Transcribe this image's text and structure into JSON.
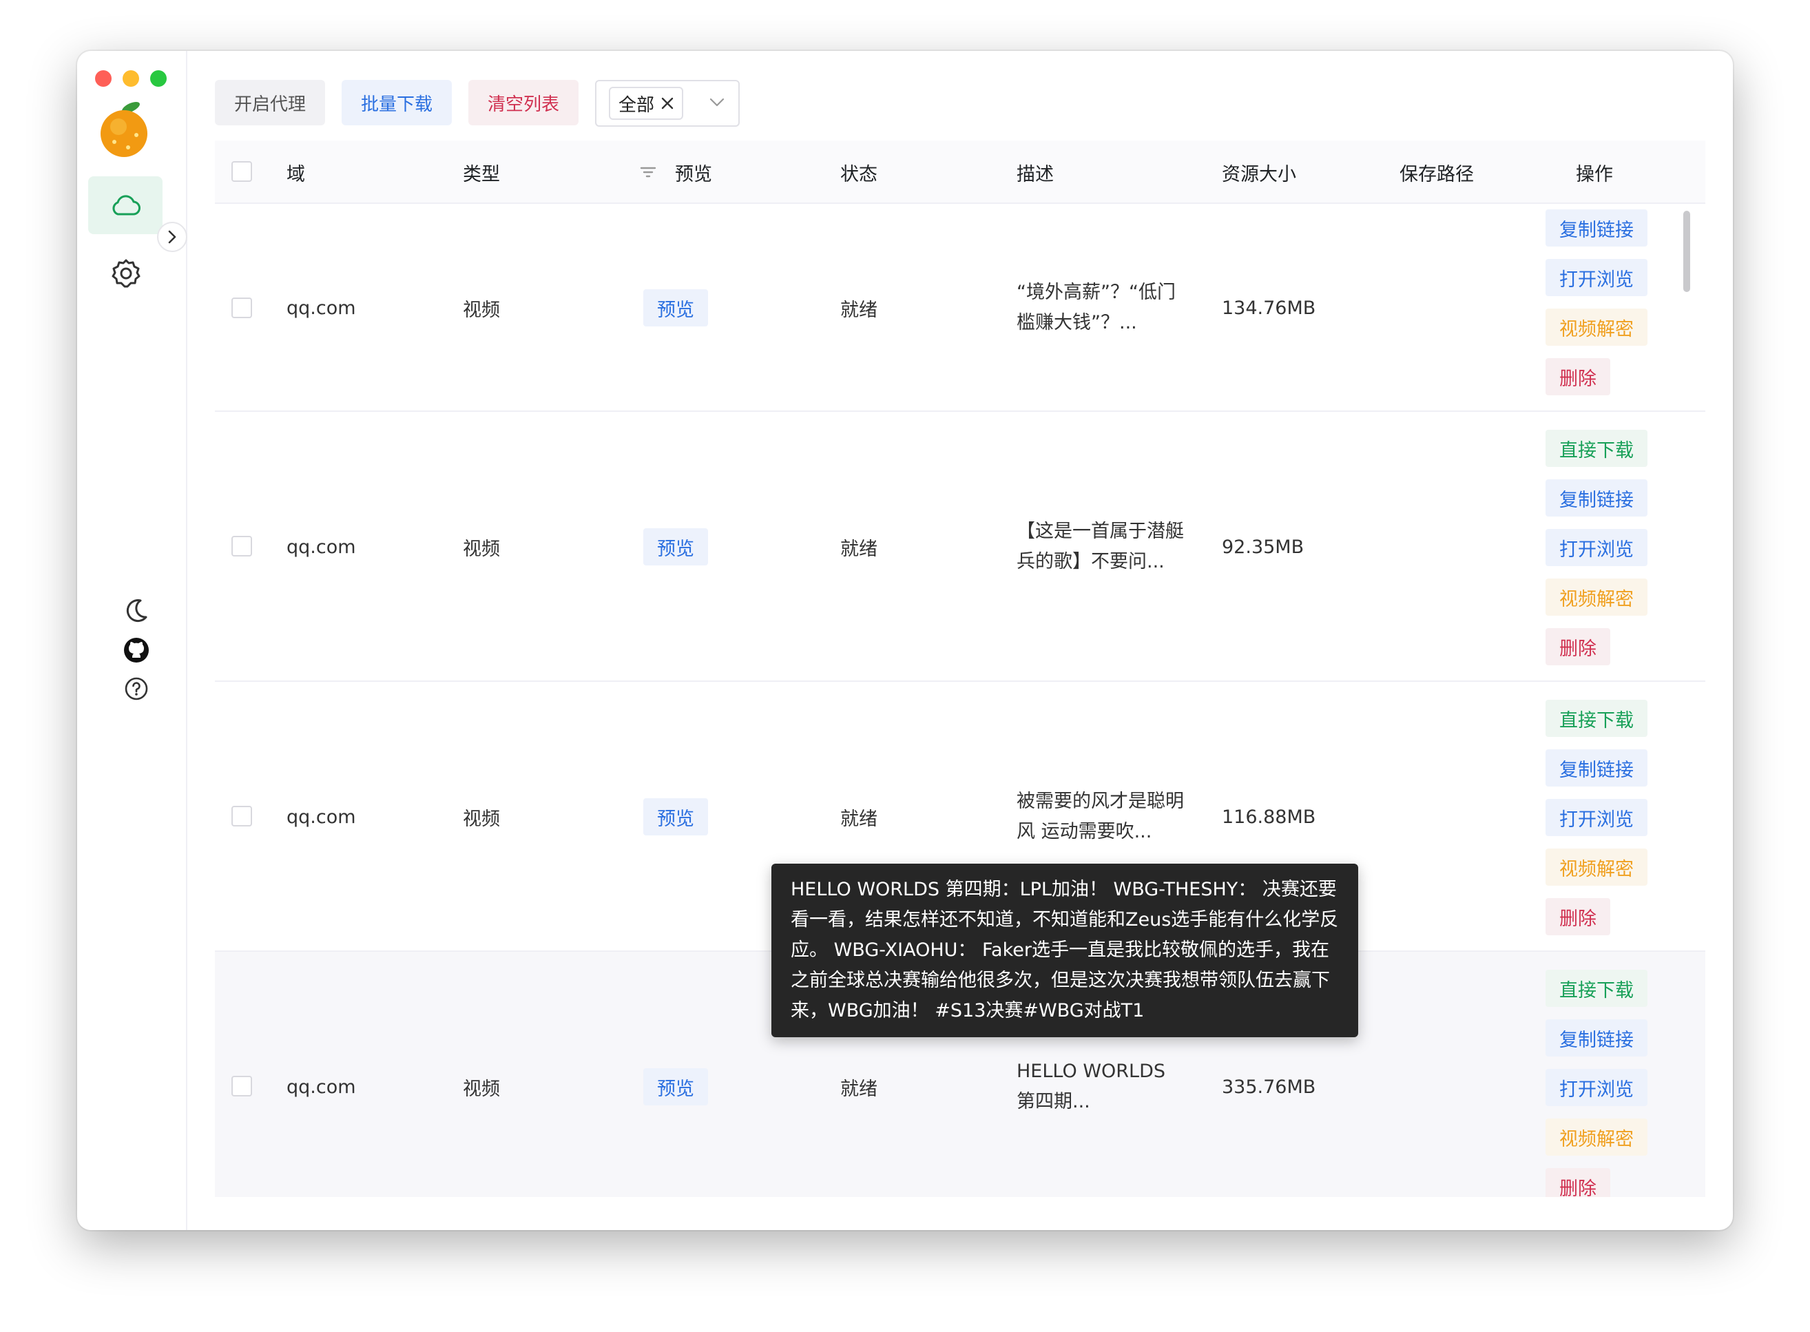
{
  "toolbar": {
    "proxy_label": "开启代理",
    "batch_download_label": "批量下载",
    "clear_list_label": "清空列表",
    "filter_tag": "全部"
  },
  "table": {
    "headers": {
      "domain": "域",
      "type": "类型",
      "preview": "预览",
      "status": "状态",
      "description": "描述",
      "size": "资源大小",
      "save_path": "保存路径",
      "actions": "操作"
    },
    "rows": [
      {
        "domain": "qq.com",
        "type": "视频",
        "preview": "预览",
        "status": "就绪",
        "description": "“境外高薪”？“低门槛赚大钱”？...",
        "size": "134.76MB",
        "actions": [
          "复制链接",
          "打开浏览",
          "视频解密",
          "删除"
        ]
      },
      {
        "domain": "qq.com",
        "type": "视频",
        "preview": "预览",
        "status": "就绪",
        "description": "【这是一首属于潜艇兵的歌】不要问...",
        "size": "92.35MB",
        "actions": [
          "直接下载",
          "复制链接",
          "打开浏览",
          "视频解密",
          "删除"
        ]
      },
      {
        "domain": "qq.com",
        "type": "视频",
        "preview": "预览",
        "status": "就绪",
        "description": "被需要的风才是聪明风 运动需要吹...",
        "size": "116.88MB",
        "actions": [
          "直接下载",
          "复制链接",
          "打开浏览",
          "视频解密",
          "删除"
        ]
      },
      {
        "domain": "qq.com",
        "type": "视频",
        "preview": "预览",
        "status": "就绪",
        "description": "HELLO WORLDS 第四期...",
        "size": "335.76MB",
        "actions": [
          "直接下载",
          "复制链接",
          "打开浏览",
          "视频解密",
          "删除"
        ]
      }
    ]
  },
  "tooltip": {
    "text": "HELLO WORLDS 第四期：LPL加油！ WBG-THESHY： 决赛还要看一看，结果怎样还不知道，不知道能和Zeus选手能有什么化学反应。 WBG-XIAOHU： Faker选手一直是我比较敬佩的选手，我在之前全球总决赛输给他很多次，但是这次决赛我想带领队伍去赢下来，WBG加油！ #S13决赛#WBG对战T1"
  },
  "icons": {
    "logo": "orange-logo-icon",
    "nav_resources": "cloud-icon",
    "nav_settings": "gear-icon",
    "collapse": "chevron-right-icon",
    "theme": "moon-icon",
    "github": "github-icon",
    "help": "help-icon"
  },
  "colors": {
    "primary_blue": "#2a6fe0",
    "success_green": "#18a058",
    "warning_orange": "#f0a020",
    "error_red": "#d03050"
  }
}
